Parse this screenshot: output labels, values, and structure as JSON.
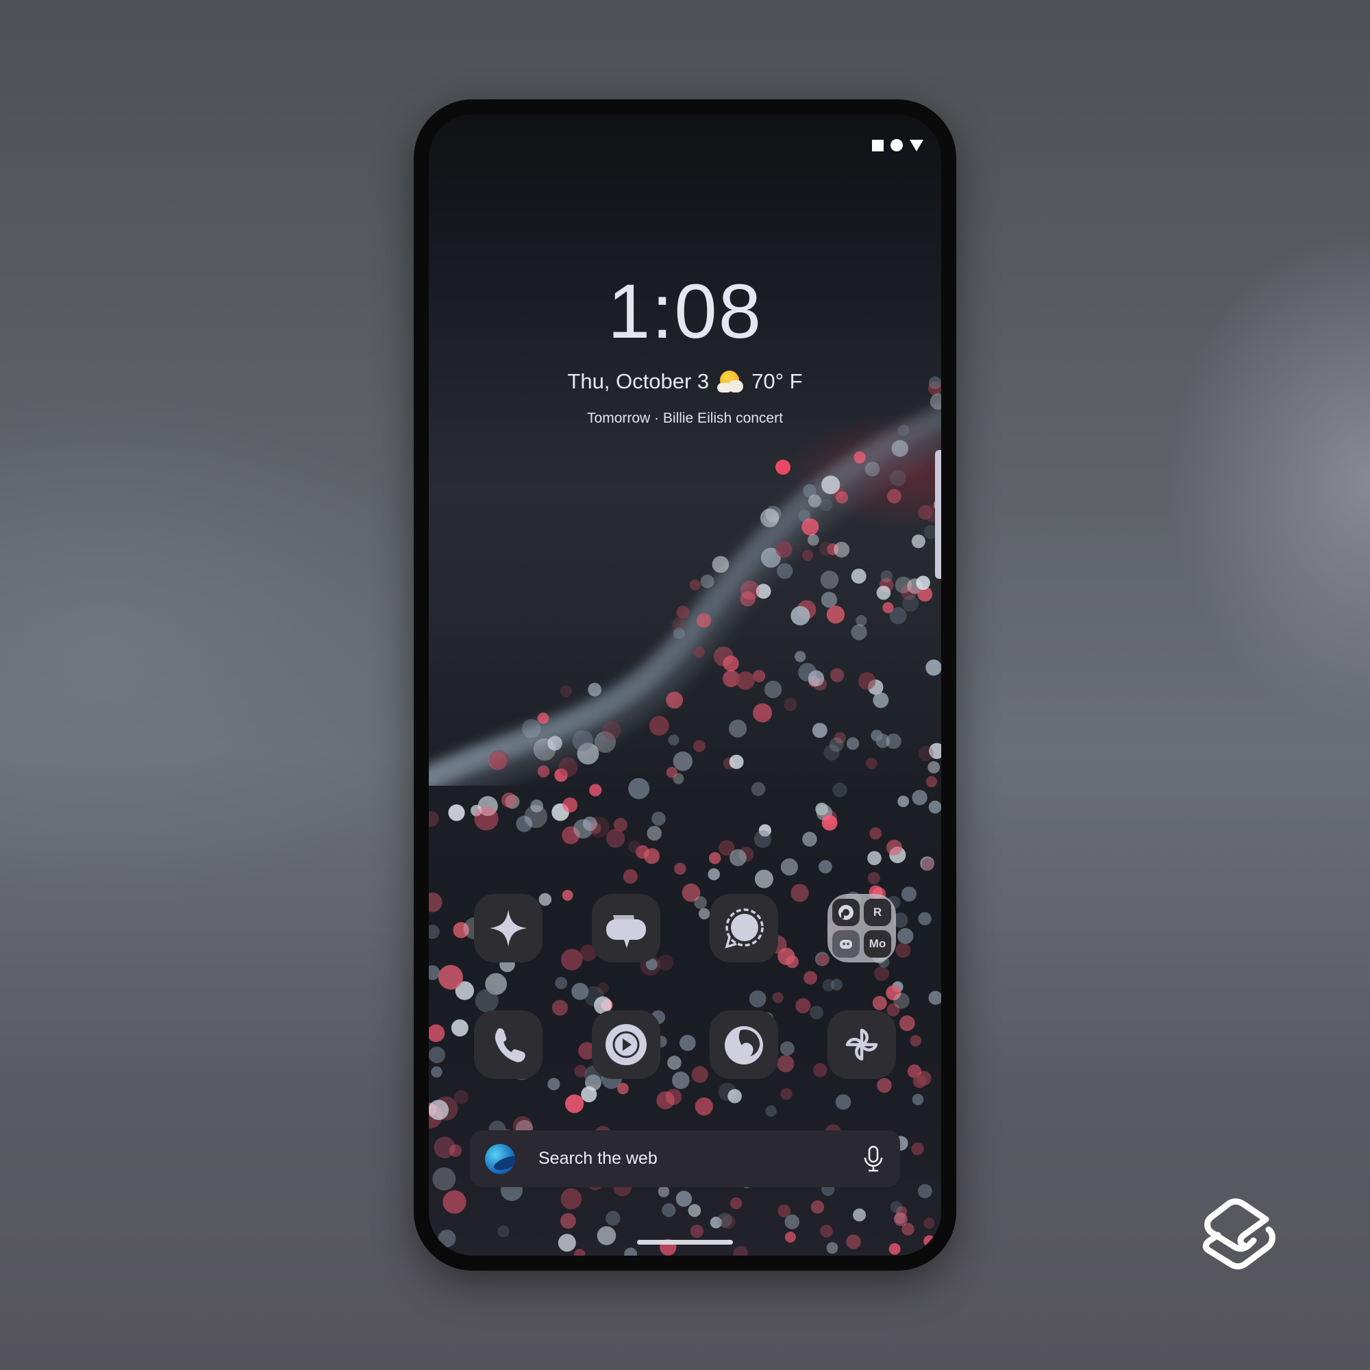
{
  "status_bar": {
    "icons": [
      "square-icon",
      "circle-icon",
      "triangle-down-icon"
    ]
  },
  "lockscreen_widget": {
    "time": "1:08",
    "date": "Thu, October 3",
    "weather_icon": "partly-sunny-icon",
    "temperature": "70° F",
    "event": "Tomorrow · Billie Eilish concert"
  },
  "home_grid": {
    "row1": [
      {
        "name": "Gemini",
        "icon": "sparkle-icon"
      },
      {
        "name": "Messages",
        "icon": "chat-bubbles-icon"
      },
      {
        "name": "Signal",
        "icon": "signal-bubble-icon"
      },
      {
        "name": "Folder",
        "icon": "folder-icon",
        "apps": [
          {
            "name": "Pocket Casts",
            "icon": "pocket-casts-icon"
          },
          {
            "name": "Reddit app R",
            "icon": "r-letter-icon",
            "label": "R"
          },
          {
            "name": "Discord",
            "icon": "discord-icon"
          },
          {
            "name": "Mo",
            "icon": "mo-icon",
            "label": "Mo"
          }
        ]
      }
    ],
    "row2": [
      {
        "name": "Phone",
        "icon": "phone-icon"
      },
      {
        "name": "YouTube Music",
        "icon": "play-circle-icon"
      },
      {
        "name": "Firefox",
        "icon": "firefox-icon"
      },
      {
        "name": "Photos",
        "icon": "pinwheel-icon"
      }
    ]
  },
  "search": {
    "placeholder": "Search the web",
    "logo_icon": "browser-logo-icon",
    "mic_icon": "microphone-icon"
  },
  "colors": {
    "icon_bg": "#2d2d32",
    "icon_fg": "#cfcfdf",
    "search_bg": "#2a2830",
    "accent_dot": "#ff4d6a"
  }
}
